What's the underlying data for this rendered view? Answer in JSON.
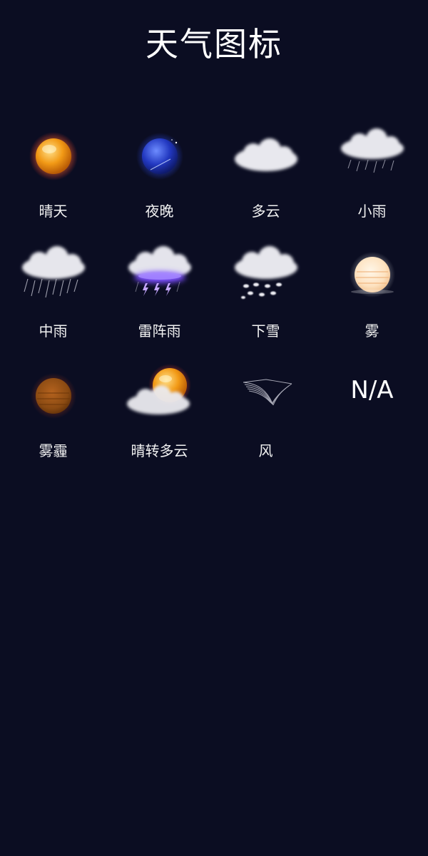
{
  "page": {
    "title": "天气图标"
  },
  "icons": [
    {
      "label": "晴天",
      "icon": "sun-icon"
    },
    {
      "label": "夜晚",
      "icon": "night-moon-icon"
    },
    {
      "label": "多云",
      "icon": "cloudy-icon"
    },
    {
      "label": "小雨",
      "icon": "light-rain-icon"
    },
    {
      "label": "中雨",
      "icon": "moderate-rain-icon"
    },
    {
      "label": "雷阵雨",
      "icon": "thunderstorm-icon"
    },
    {
      "label": "下雪",
      "icon": "snow-icon"
    },
    {
      "label": "雾",
      "icon": "fog-icon"
    },
    {
      "label": "雾霾",
      "icon": "haze-icon"
    },
    {
      "label": "晴转多云",
      "icon": "sun-with-cloud-icon"
    },
    {
      "label": "风",
      "icon": "wind-icon"
    },
    {
      "label": "",
      "icon": "na-icon",
      "text": "N/A"
    }
  ],
  "colors": {
    "background": "#0b0d22",
    "sun": "#f0a21a",
    "night": "#2440c8",
    "cloud": "#e8e8ee",
    "thunder": "#7b4dff",
    "haze": "#8a4a12",
    "fog_sun": "#fde2c0"
  }
}
